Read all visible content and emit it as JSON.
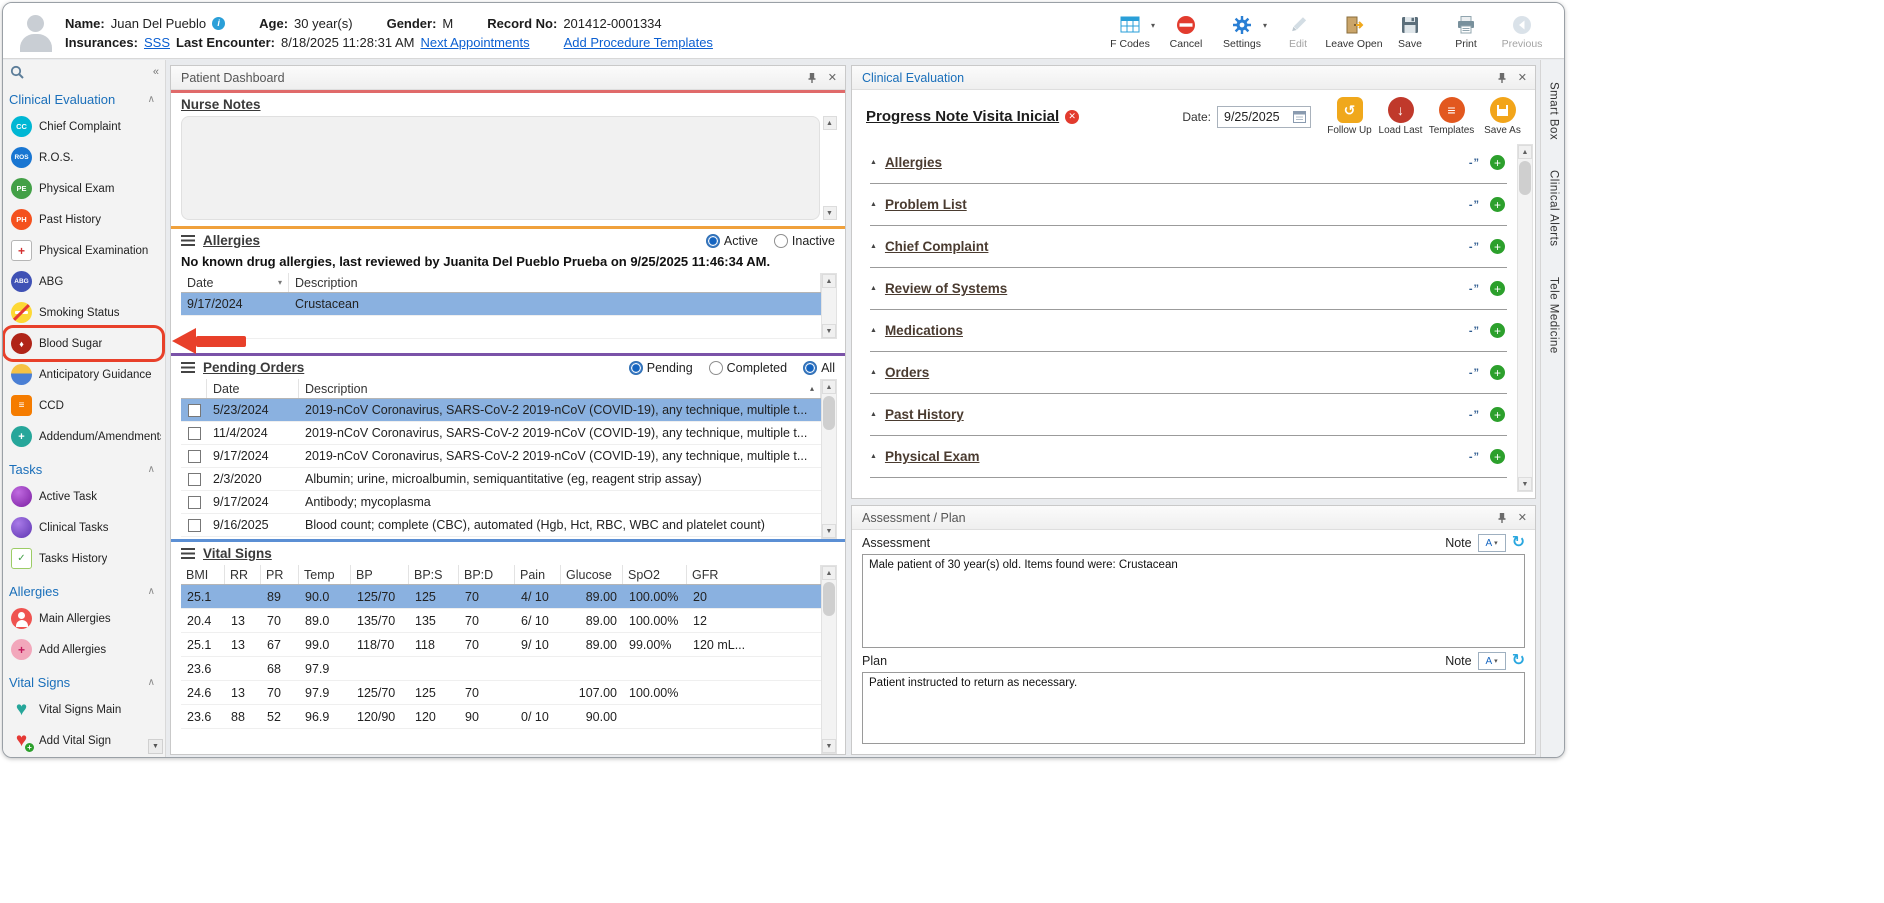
{
  "colors": {
    "link": "#0b5fd1",
    "selected_row": "#8ab1e0",
    "sidebar_section_title": "#1a6fba",
    "panel_title_blue": "#1a6fba",
    "nurse_notes_bar": "#e06a6a",
    "allergies_bar": "#f0a13c",
    "pending_orders_bar": "#7a52a8",
    "vital_signs_bar": "#5b8fd4",
    "annotation_red": "#e8402a",
    "add_green": "#2ca02c",
    "delete_red": "#e23b2e"
  },
  "header": {
    "name_label": "Name:",
    "name_value": "Juan Del Pueblo",
    "age_label": "Age:",
    "age_value": "30 year(s)",
    "gender_label": "Gender:",
    "gender_value": "M",
    "record_label": "Record No:",
    "record_value": "201412-0001334",
    "insurances_label": "Insurances:",
    "insurances_value": "SSS",
    "last_encounter_label": "Last Encounter:",
    "last_encounter_value": "8/18/2025 11:28:31 AM",
    "next_appointments_link": "Next Appointments",
    "add_procedure_link": "Add Procedure Templates",
    "toolbar": [
      {
        "label": "F Codes"
      },
      {
        "label": "Cancel"
      },
      {
        "label": "Settings"
      },
      {
        "label": "Edit"
      },
      {
        "label": "Leave Open"
      },
      {
        "label": "Save"
      },
      {
        "label": "Print"
      },
      {
        "label": "Previous"
      }
    ]
  },
  "sidebar": {
    "sections": [
      {
        "title": "Clinical Evaluation",
        "items": [
          {
            "label": "Chief Complaint",
            "icon_text": "CC"
          },
          {
            "label": "R.O.S.",
            "icon_text": "ROS"
          },
          {
            "label": "Physical Exam",
            "icon_text": "PE"
          },
          {
            "label": "Past History",
            "icon_text": "PH"
          },
          {
            "label": "Physical Examination",
            "icon_text": ""
          },
          {
            "label": "ABG",
            "icon_text": "ABG"
          },
          {
            "label": "Smoking Status",
            "icon_text": ""
          },
          {
            "label": "Blood Sugar",
            "icon_text": "",
            "highlighted": true
          },
          {
            "label": "Anticipatory Guidance",
            "icon_text": ""
          },
          {
            "label": "CCD",
            "icon_text": ""
          },
          {
            "label": "Addendum/Amendments",
            "icon_text": ""
          }
        ]
      },
      {
        "title": "Tasks",
        "items": [
          {
            "label": "Active Task"
          },
          {
            "label": "Clinical Tasks"
          },
          {
            "label": "Tasks History"
          }
        ]
      },
      {
        "title": "Allergies",
        "items": [
          {
            "label": "Main Allergies"
          },
          {
            "label": "Add Allergies"
          }
        ]
      },
      {
        "title": "Vital Signs",
        "items": [
          {
            "label": "Vital Signs Main"
          },
          {
            "label": "Add Vital Sign"
          }
        ]
      }
    ]
  },
  "dashboard": {
    "title": "Patient Dashboard",
    "nurse_notes": {
      "title": "Nurse Notes",
      "content": ""
    },
    "allergies": {
      "title": "Allergies",
      "radio_active": "Active",
      "radio_inactive": "Inactive",
      "review_text": "No known drug allergies, last reviewed by Juanita Del Pueblo Prueba on 9/25/2025 11:46:34 AM.",
      "columns": [
        "Date",
        "Description"
      ],
      "rows": [
        {
          "date": "9/17/2024",
          "description": "Crustacean",
          "selected": true
        }
      ]
    },
    "pending_orders": {
      "title": "Pending Orders",
      "radios": [
        "Pending",
        "Completed",
        "All"
      ],
      "selected_radio": "Pending",
      "columns": [
        "Date",
        "Description"
      ],
      "rows": [
        {
          "date": "5/23/2024",
          "description": "2019-nCoV Coronavirus, SARS-CoV-2 2019-nCoV (COVID-19), any technique, multiple t...",
          "selected": true
        },
        {
          "date": "11/4/2024",
          "description": "2019-nCoV Coronavirus, SARS-CoV-2 2019-nCoV (COVID-19), any technique, multiple t..."
        },
        {
          "date": "9/17/2024",
          "description": "2019-nCoV Coronavirus, SARS-CoV-2 2019-nCoV (COVID-19), any technique, multiple t..."
        },
        {
          "date": "2/3/2020",
          "description": "Albumin; urine, microalbumin, semiquantitative (eg, reagent strip assay)"
        },
        {
          "date": "9/17/2024",
          "description": "Antibody; mycoplasma"
        },
        {
          "date": "9/16/2025",
          "description": "Blood count; complete (CBC), automated (Hgb, Hct, RBC, WBC and platelet count)"
        }
      ]
    },
    "vital_signs": {
      "title": "Vital Signs",
      "columns": [
        "BMI",
        "RR",
        "PR",
        "Temp",
        "BP",
        "BP:S",
        "BP:D",
        "Pain",
        "Glucose",
        "SpO2",
        "GFR"
      ],
      "rows": [
        {
          "cells": [
            "25.1",
            "",
            "89",
            "90.0",
            "125/70",
            "125",
            "70",
            "4/ 10",
            "89.00",
            "100.00%",
            "20"
          ],
          "selected": true
        },
        {
          "cells": [
            "20.4",
            "13",
            "70",
            "89.0",
            "135/70",
            "135",
            "70",
            "6/ 10",
            "89.00",
            "100.00%",
            "12"
          ]
        },
        {
          "cells": [
            "25.1",
            "13",
            "67",
            "99.0",
            "118/70",
            "118",
            "70",
            "9/ 10",
            "89.00",
            "99.00%",
            "120 mL..."
          ]
        },
        {
          "cells": [
            "23.6",
            "",
            "68",
            "97.9",
            "",
            "",
            "",
            "",
            "",
            "",
            ""
          ]
        },
        {
          "cells": [
            "24.6",
            "13",
            "70",
            "97.9",
            "125/70",
            "125",
            "70",
            "",
            "107.00",
            "100.00%",
            ""
          ]
        },
        {
          "cells": [
            "23.6",
            "88",
            "52",
            "96.9",
            "120/90",
            "120",
            "90",
            "0/ 10",
            "90.00",
            "",
            ""
          ]
        }
      ]
    }
  },
  "clinical_eval": {
    "title": "Clinical Evaluation",
    "note_title": "Progress Note Visita Inicial",
    "date_label": "Date:",
    "date_value": "9/25/2025",
    "buttons": [
      {
        "label": "Follow Up"
      },
      {
        "label": "Load Last"
      },
      {
        "label": "Templates"
      },
      {
        "label": "Save As"
      }
    ],
    "sections": [
      {
        "title": "Allergies"
      },
      {
        "title": "Problem List"
      },
      {
        "title": "Chief Complaint"
      },
      {
        "title": "Review of Systems"
      },
      {
        "title": "Medications"
      },
      {
        "title": "Orders"
      },
      {
        "title": "Past History"
      },
      {
        "title": "Physical Exam"
      }
    ]
  },
  "assessment_plan": {
    "title": "Assessment / Plan",
    "assessment_label": "Assessment",
    "plan_label": "Plan",
    "note_label": "Note",
    "assessment_text": "Male patient of 30 year(s) old. Items found were:  Crustacean",
    "plan_text": "Patient instructed to return as necessary."
  },
  "right_strip": {
    "tabs": [
      "Smart Box",
      "Clinical Alerts",
      "Tele Medicine"
    ]
  }
}
